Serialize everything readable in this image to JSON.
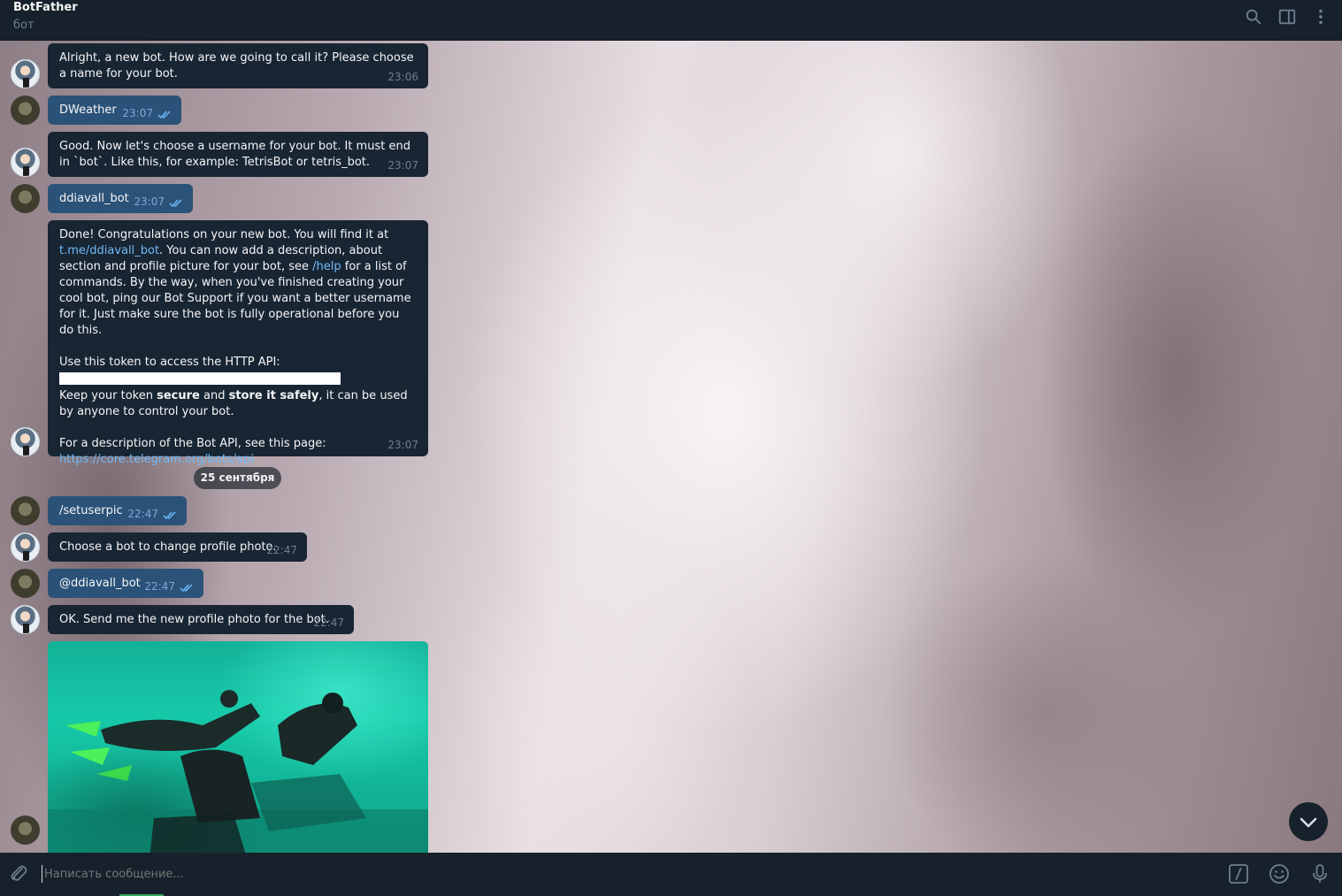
{
  "header": {
    "title": "BotFather",
    "subtitle": "бот",
    "icons": [
      "search-icon",
      "sidebar-toggle-icon",
      "more-vertical-icon"
    ]
  },
  "messages": [
    {
      "kind": "in",
      "text": "Alright, a new bot. How are we going to call it? Please choose a name for your bot.",
      "time": "23:06"
    },
    {
      "kind": "out",
      "text": "DWeather",
      "time": "23:07"
    },
    {
      "kind": "in",
      "text": "Good. Now let's choose a username for your bot. It must end in `bot`. Like this, for example: TetrisBot or tetris_bot.",
      "time": "23:07"
    },
    {
      "kind": "out",
      "text": "ddiavall_bot",
      "time": "23:07"
    },
    {
      "kind": "in",
      "p1_a": "Done! Congratulations on your new bot. You will find it at ",
      "p1_link": "t.me/ddiavall_bot",
      "p1_b": ". You can now add a description, about section and profile picture for your bot, see ",
      "p1_help": "/help",
      "p1_c": " for a list of commands. By the way, when you've finished creating your cool bot, ping our Bot Support if you want a better username for it. Just make sure the bot is fully operational before you do this.",
      "p2": "Use this token to access the HTTP API:",
      "p3_a": "Keep your token ",
      "p3_secure": "secure",
      "p3_b": " and ",
      "p3_store": "store it safely",
      "p3_c": ", it can be used by anyone to control your bot.",
      "p4": "For a description of the Bot API, see this page:",
      "p4_link": "https://core.telegram.org/bots/api",
      "time": "23:07"
    },
    {
      "kind": "out",
      "text": "/setuserpic",
      "time": "22:47"
    },
    {
      "kind": "in",
      "text": "Choose a bot to change profile photo.",
      "time": "22:47"
    },
    {
      "kind": "out",
      "text": "@ddiavall_bot",
      "time": "22:47"
    },
    {
      "kind": "in",
      "text": "OK. Send me the new profile photo for the bot.",
      "time": "22:47"
    }
  ],
  "date_separator": "25 сентября",
  "photo": {
    "description_icon": "underwater-divers-photo"
  },
  "input": {
    "placeholder": "Написать сообщение...",
    "icons": [
      "attach-icon",
      "bot-commands-icon",
      "emoji-icon",
      "microphone-icon"
    ]
  },
  "colors": {
    "header_bg": "#17212b",
    "incoming_bubble": "#182533",
    "outgoing_bubble": "#2b5278",
    "link": "#71baf8",
    "muted": "#6d7f8f"
  }
}
